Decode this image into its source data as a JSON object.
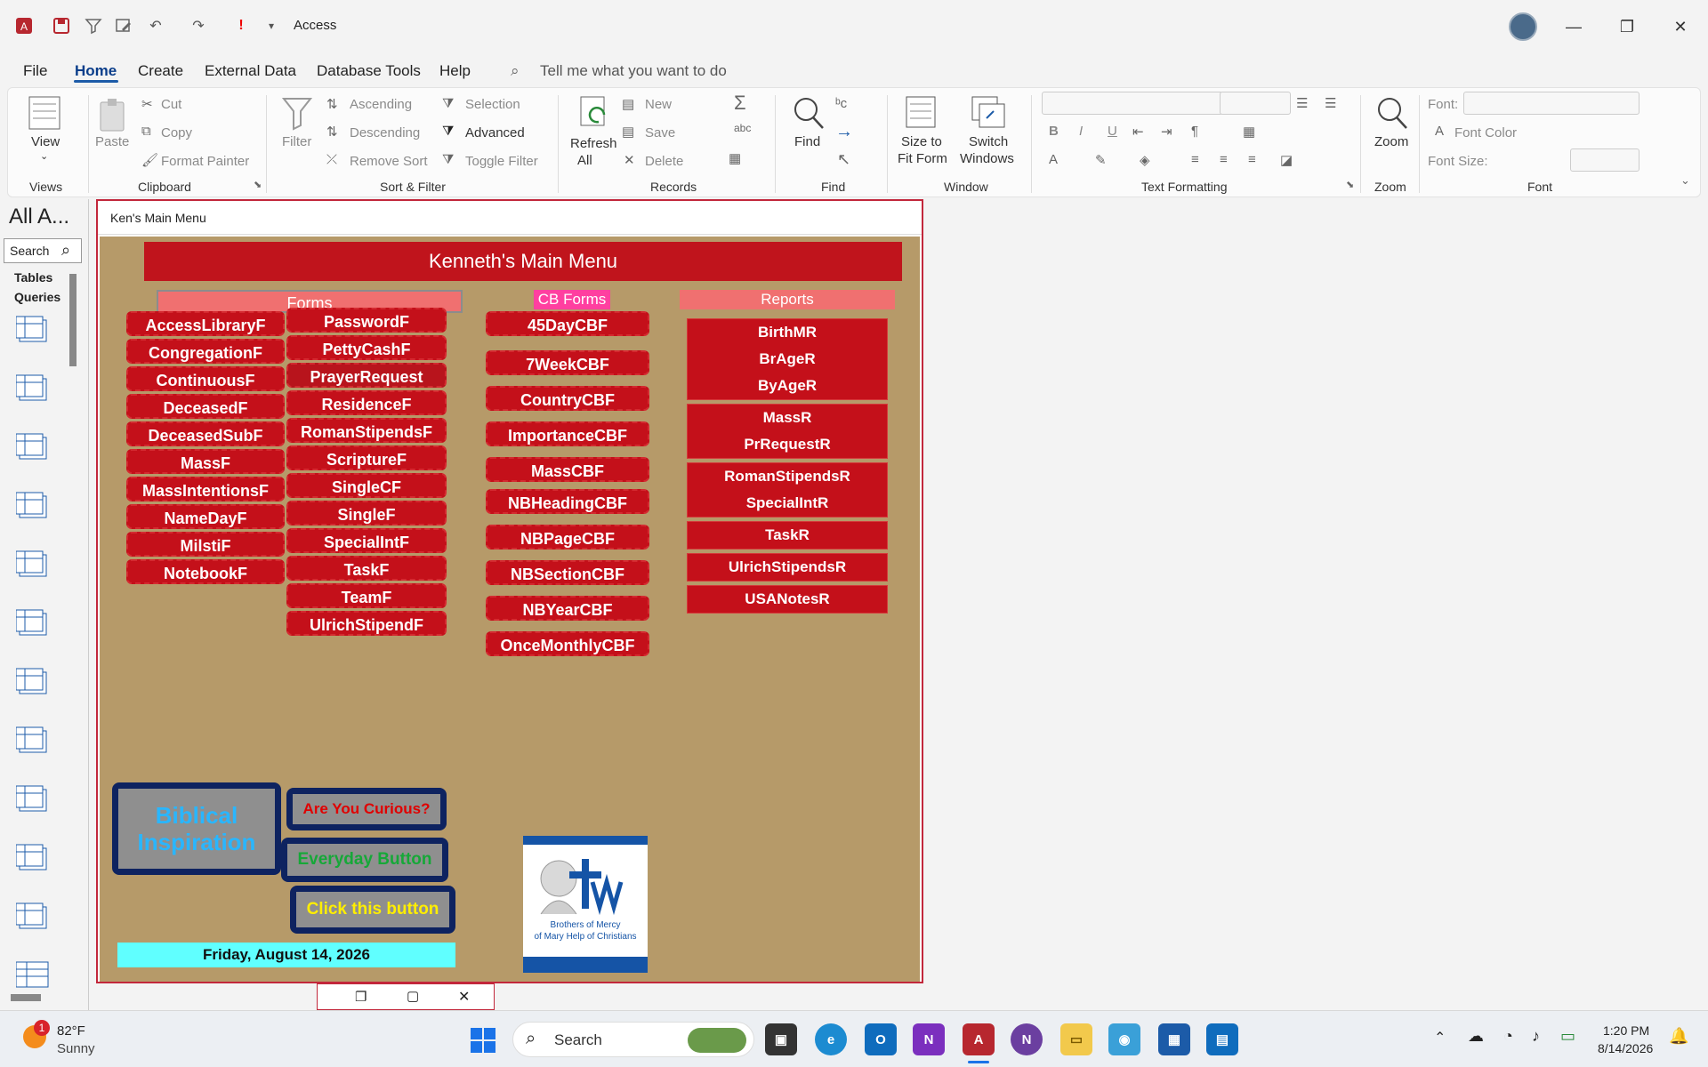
{
  "app": {
    "title": "Access"
  },
  "menu": {
    "tabs": [
      "File",
      "Home",
      "Create",
      "External Data",
      "Database Tools",
      "Help"
    ],
    "tell_me": "Tell me what you want to do"
  },
  "ribbon": {
    "views": {
      "view": "View",
      "group": "Views"
    },
    "clipboard": {
      "paste": "Paste",
      "cut": "Cut",
      "copy": "Copy",
      "format_painter": "Format Painter",
      "group": "Clipboard"
    },
    "sort_filter": {
      "filter": "Filter",
      "ascending": "Ascending",
      "descending": "Descending",
      "remove_sort": "Remove Sort",
      "selection": "Selection",
      "advanced": "Advanced",
      "toggle_filter": "Toggle Filter",
      "group": "Sort & Filter"
    },
    "records": {
      "refresh": "Refresh",
      "refresh_all": "All",
      "new": "New",
      "save": "Save",
      "delete": "Delete",
      "group": "Records"
    },
    "find": {
      "find": "Find",
      "group": "Find"
    },
    "window": {
      "size_to": "Size to",
      "fit_form": "Fit Form",
      "switch": "Switch",
      "windows": "Windows",
      "group": "Window"
    },
    "text_formatting": {
      "group": "Text Formatting",
      "bold": "B",
      "italic": "I",
      "underline": "U"
    },
    "zoom": {
      "zoom": "Zoom",
      "group": "Zoom"
    },
    "font": {
      "font_label": "Font:",
      "font_color": "Font Color",
      "font_size": "Font Size:",
      "group": "Font"
    }
  },
  "nav": {
    "title": "All A...",
    "search_placeholder": "Search",
    "tables": "Tables",
    "queries": "Queries"
  },
  "form": {
    "tab_title": "Ken's Main Menu",
    "header": "Kenneth's Main Menu",
    "forms_label": "Forms",
    "cb_forms_label": "CB Forms",
    "reports_label": "Reports",
    "forms_col1": [
      "AccessLibraryF",
      "CongregationF",
      "ContinuousF",
      "DeceasedF",
      "DeceasedSubF",
      "MassF",
      "MassIntentionsF",
      "NameDayF",
      "MilstiF",
      "NotebookF"
    ],
    "forms_col2": [
      "PasswordF",
      "PettyCashF",
      "PrayerRequest",
      "ResidenceF",
      "RomanStipendsF",
      "ScriptureF",
      "SingleCF",
      "SingleF",
      "SpecialIntF",
      "TaskF",
      "TeamF",
      "UlrichStipendF"
    ],
    "cb_forms": [
      "45DayCBF",
      "7WeekCBF",
      "CountryCBF",
      "ImportanceCBF",
      "MassCBF",
      "NBHeadingCBF",
      "NBPageCBF",
      "NBSectionCBF",
      "NBYearCBF",
      "OnceMonthlyCBF"
    ],
    "reports_groups": [
      [
        "BirthMR",
        "BrAgeR",
        "ByAgeR"
      ],
      [
        "MassR",
        "PrRequestR"
      ],
      [
        "RomanStipendsR",
        "SpecialIntR"
      ],
      [
        "TaskR"
      ],
      [
        "UlrichStipendsR"
      ],
      [
        "USANotesR"
      ]
    ],
    "biblical": "Biblical Inspiration",
    "curious": "Are You Curious?",
    "everyday": "Everyday Button",
    "click_this": "Click this button",
    "date": "Friday, August 14, 2026",
    "logo_line1": "Brothers of Mercy",
    "logo_line2": "of Mary Help of Christians"
  },
  "taskbar": {
    "temp": "82°F",
    "weather": "Sunny",
    "badge": "1",
    "search": "Search",
    "time": "1:20 PM",
    "date": "8/14/2026"
  },
  "colors": {
    "form_bg": "#b69a69",
    "button_red": "#c4101a",
    "navy": "#0e2360",
    "cyan_date": "#60ffff",
    "pink_cb": "#ff3fa0"
  }
}
